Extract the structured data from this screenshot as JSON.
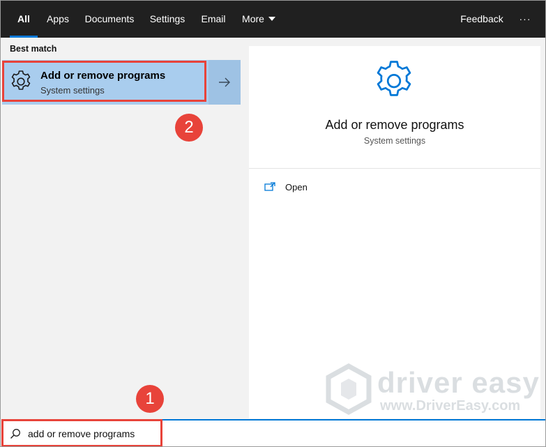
{
  "tabs": [
    {
      "label": "All",
      "active": true
    },
    {
      "label": "Apps"
    },
    {
      "label": "Documents"
    },
    {
      "label": "Settings"
    },
    {
      "label": "Email"
    },
    {
      "label": "More"
    }
  ],
  "header": {
    "feedback_label": "Feedback",
    "ellipsis_label": "···"
  },
  "results": {
    "section_label": "Best match",
    "best_match": {
      "title": "Add or remove programs",
      "subtitle": "System settings",
      "icon": "gear-icon"
    }
  },
  "detail": {
    "title": "Add or remove programs",
    "subtitle": "System settings",
    "icon": "gear-icon",
    "actions": [
      {
        "label": "Open",
        "icon": "open-window-icon"
      }
    ]
  },
  "annotations": {
    "step1": "1",
    "step2": "2"
  },
  "watermark": {
    "brand": "driver easy",
    "url": "www.DriverEasy.com"
  },
  "search": {
    "value": "add or remove programs"
  },
  "colors": {
    "accent": "#0078d7",
    "highlight": "#a9cdee",
    "annotation": "#e8433a",
    "topbar": "#202020"
  }
}
